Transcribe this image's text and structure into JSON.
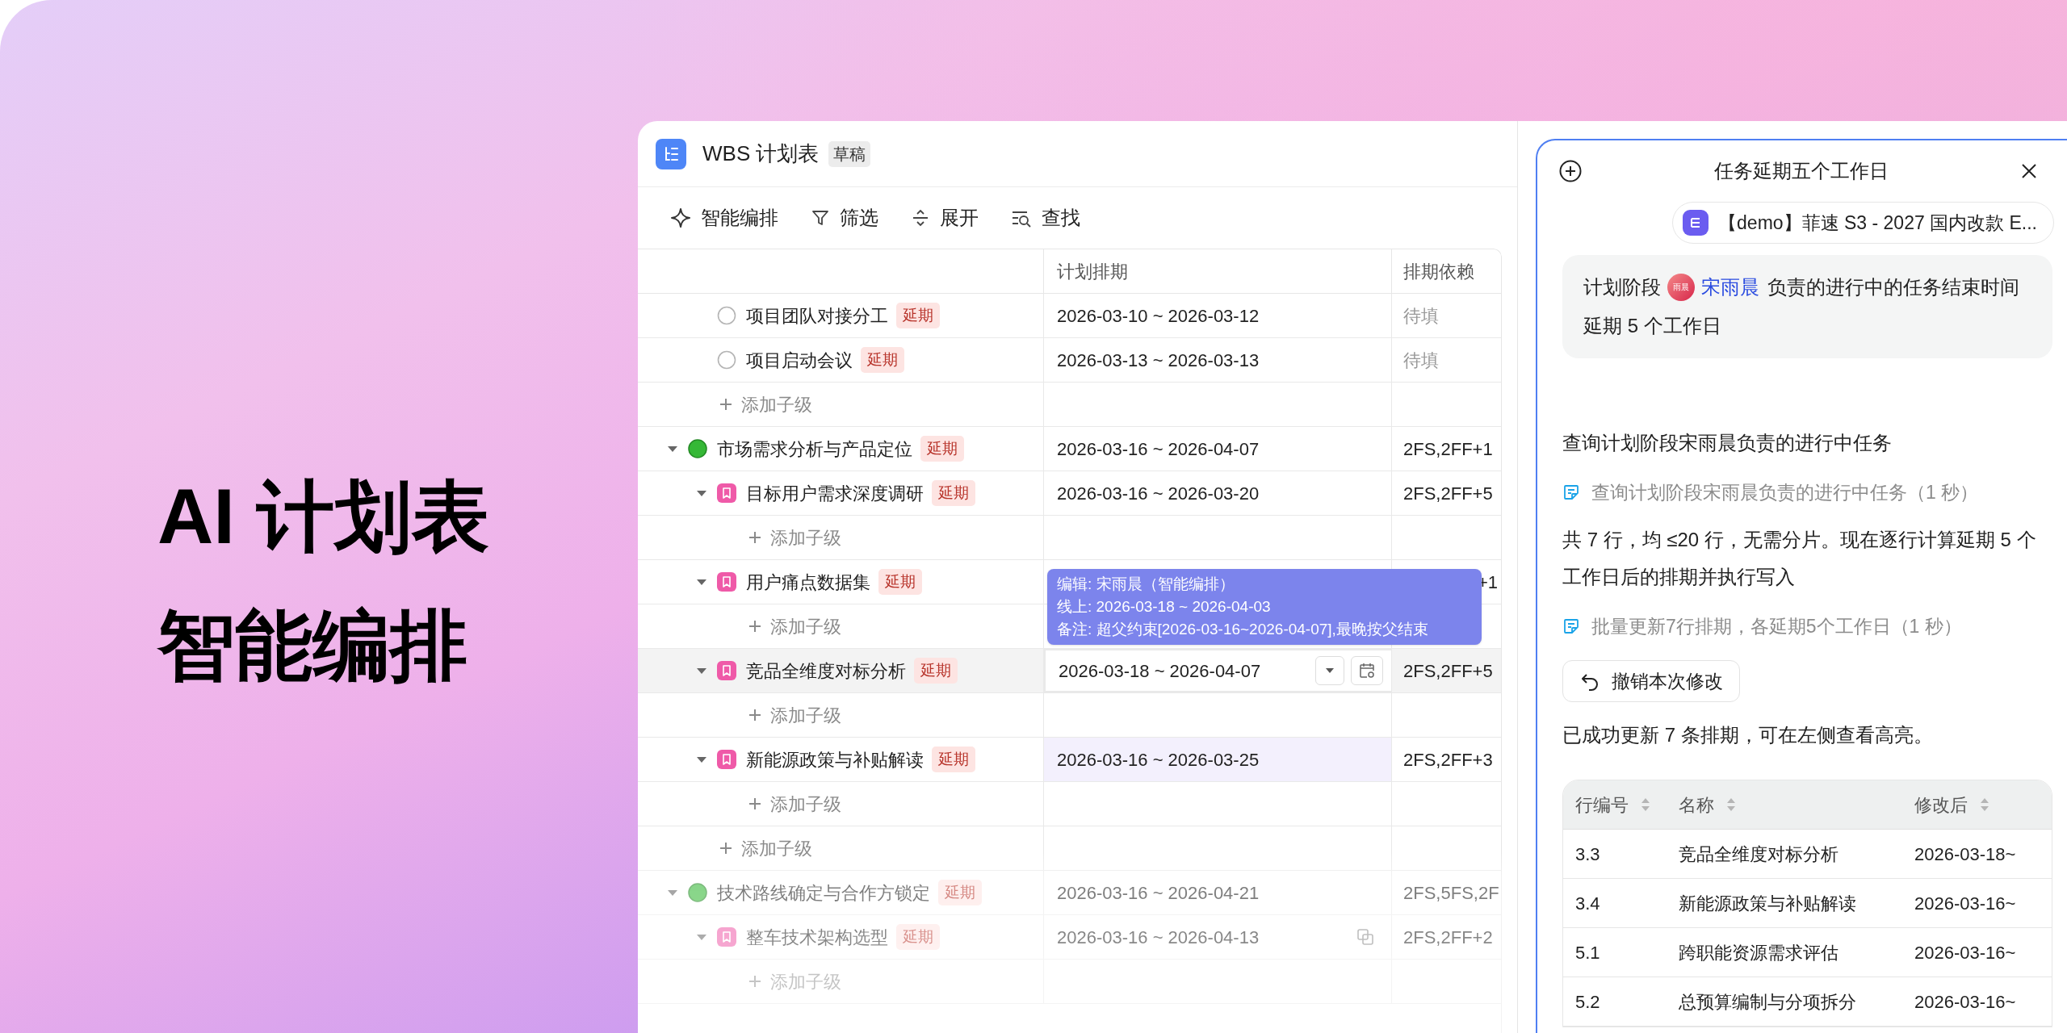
{
  "headline": [
    "AI 计划表",
    "智能编排"
  ],
  "sheet": {
    "title": "WBS 计划表",
    "badge": "草稿",
    "toolbar": [
      {
        "kind": "sparkle",
        "label": "智能编排"
      },
      {
        "kind": "filter",
        "label": "筛选"
      },
      {
        "kind": "expand",
        "label": "展开"
      },
      {
        "kind": "find",
        "label": "查找"
      }
    ],
    "columns": [
      "计划排期",
      "排期依赖"
    ],
    "rows": [
      {
        "kind": "continued",
        "children": [
          {
            "kind": "milestone",
            "label": "项目团队对接分工",
            "badge": "延期",
            "schedule": "2026-03-10 ~ 2026-03-12",
            "dependency": "待填",
            "pending": true,
            "selected": false,
            "highlighted": false,
            "hovered": false
          },
          {
            "kind": "milestone",
            "label": "项目启动会议",
            "badge": "延期",
            "schedule": "2026-03-13 ~ 2026-03-13",
            "dependency": "待填",
            "pending": true,
            "selected": false,
            "highlighted": false,
            "hovered": false
          },
          {
            "kind": "add",
            "label": "添加子级"
          }
        ]
      },
      {
        "kind": "phase",
        "label": "市场需求分析与产品定位",
        "badge": "延期",
        "schedule": "2026-03-16 ~ 2026-04-07",
        "dependency": "2FS,2FF+1",
        "pending": false,
        "expanded": true,
        "selected": false,
        "highlighted": false,
        "hovered": false,
        "children": [
          {
            "kind": "task",
            "label": "目标用户需求深度调研",
            "badge": "延期",
            "schedule": "2026-03-16 ~ 2026-03-20",
            "dependency": "2FS,2FF+5",
            "pending": false,
            "expanded": true,
            "selected": false,
            "highlighted": false,
            "hovered": false,
            "children": [
              {
                "kind": "add",
                "label": "添加子级"
              }
            ]
          },
          {
            "kind": "task",
            "label": "用户痛点数据集",
            "badge": "延期",
            "dependency": "+1",
            "pending": false,
            "expanded": true,
            "selected": false,
            "highlighted": false,
            "hovered": false,
            "children": [
              {
                "kind": "add",
                "label": "添加子级"
              }
            ]
          },
          {
            "kind": "task",
            "label": "竞品全维度对标分析",
            "badge": "延期",
            "schedule": "2026-03-18 ~ 2026-04-07",
            "dependency": "2FS,2FF+5",
            "pending": false,
            "expanded": true,
            "selected": true,
            "highlighted": false,
            "hovered": false,
            "children": [
              {
                "kind": "add",
                "label": "添加子级"
              }
            ]
          },
          {
            "kind": "task",
            "label": "新能源政策与补贴解读",
            "badge": "延期",
            "schedule": "2026-03-16 ~ 2026-03-25",
            "dependency": "2FS,2FF+3",
            "pending": false,
            "expanded": true,
            "selected": false,
            "highlighted": true,
            "hovered": false,
            "children": [
              {
                "kind": "add",
                "label": "添加子级"
              }
            ]
          },
          {
            "kind": "add",
            "label": "添加子级"
          }
        ]
      },
      {
        "kind": "phase",
        "label": "技术路线确定与合作方锁定",
        "badge": "延期",
        "schedule": "2026-03-16 ~ 2026-04-21",
        "dependency": "2FS,5FS,2F",
        "pending": false,
        "expanded": true,
        "selected": false,
        "highlighted": false,
        "hovered": false,
        "children": [
          {
            "kind": "task",
            "label": "整车技术架构选型",
            "badge": "延期",
            "schedule": "2026-03-16 ~ 2026-04-13",
            "dependency": "2FS,2FF+2",
            "pending": false,
            "expanded": true,
            "selected": false,
            "highlighted": false,
            "hovered": true,
            "children": [
              {
                "kind": "add",
                "label": "添加子级"
              }
            ]
          }
        ]
      }
    ],
    "tooltip": {
      "lines": [
        "编辑: 宋雨晨（智能编排）",
        "线上: 2026-03-18 ~ 2026-04-03",
        "备注: 超父约束[2026-03-16~2026-04-07],最晚按父结束"
      ]
    }
  },
  "assistant": {
    "title": "任务延期五个工作日",
    "context": "【demo】菲速 S3 - 2027 国内改款 E...",
    "messages": [
      {
        "kind": "user",
        "before": "计划阶段",
        "avatar": "雨晨",
        "mention": "宋雨晨",
        "after": "负责的进行中的任务结束时间延期 5 个工作日"
      },
      {
        "kind": "text",
        "text": "查询计划阶段宋雨晨负责的进行中任务"
      },
      {
        "kind": "tool",
        "text": "查询计划阶段宋雨晨负责的进行中任务（1 秒）"
      },
      {
        "kind": "text",
        "text": "共 7 行，均 ≤20 行，无需分片。现在逐行计算延期 5 个工作日后的排期并执行写入"
      },
      {
        "kind": "tool",
        "text": "批量更新7行排期，各延期5个工作日（1 秒）"
      },
      {
        "kind": "button",
        "text": "撤销本次修改"
      },
      {
        "kind": "text",
        "text": "已成功更新 7 条排期，可在左侧查看高亮。"
      },
      {
        "kind": "table",
        "columns": [
          "行编号",
          "名称",
          "修改后"
        ],
        "rows": [
          [
            "3.3",
            "竞品全维度对标分析",
            "2026-03-18~"
          ],
          [
            "3.4",
            "新能源政策与补贴解读",
            "2026-03-16~"
          ],
          [
            "5.1",
            "跨职能资源需求评估",
            "2026-03-16~"
          ],
          [
            "5.2",
            "总预算编制与分项拆分",
            "2026-03-16~"
          ]
        ]
      }
    ]
  }
}
